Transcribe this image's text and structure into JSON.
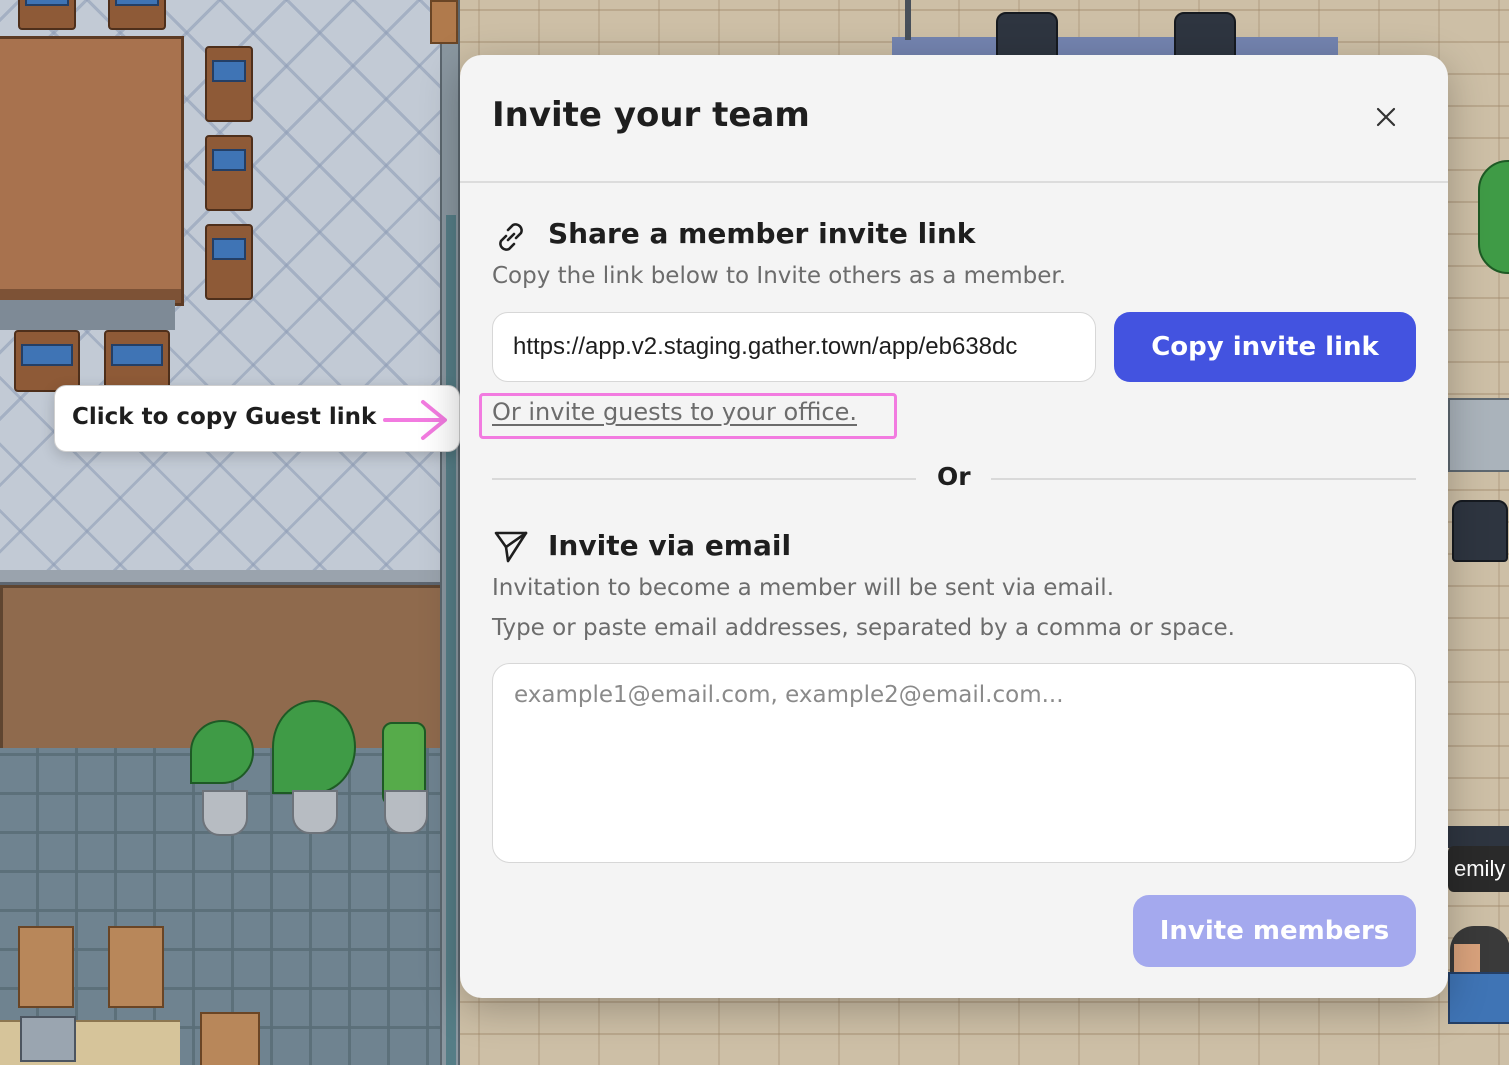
{
  "modal": {
    "title": "Invite your team",
    "close_icon": "close-icon"
  },
  "member_link_section": {
    "icon": "link-icon",
    "title": "Share a member invite link",
    "description": "Copy the link below to Invite others as a member.",
    "invite_url": "https://app.v2.staging.gather.town/app/eb638dc",
    "copy_button_label": "Copy invite link",
    "guest_link_label": "Or invite guests to your office."
  },
  "divider": {
    "label": "Or"
  },
  "email_section": {
    "icon": "send-icon",
    "title": "Invite via email",
    "description_line1": "Invitation to become a member will be sent via email.",
    "description_line2": "Type or paste email addresses, separated by a comma or space.",
    "placeholder": "example1@email.com, example2@email.com...",
    "invite_button_label": "Invite members"
  },
  "callout": {
    "text": "Click to copy Guest link",
    "arrow_icon": "arrow-right-icon"
  },
  "avatar_name_tag": "emily",
  "colors": {
    "primary_button": "#4353e0",
    "disabled_button": "#a4a9ee",
    "highlight": "#f27be0",
    "modal_background": "#f4f4f4"
  }
}
